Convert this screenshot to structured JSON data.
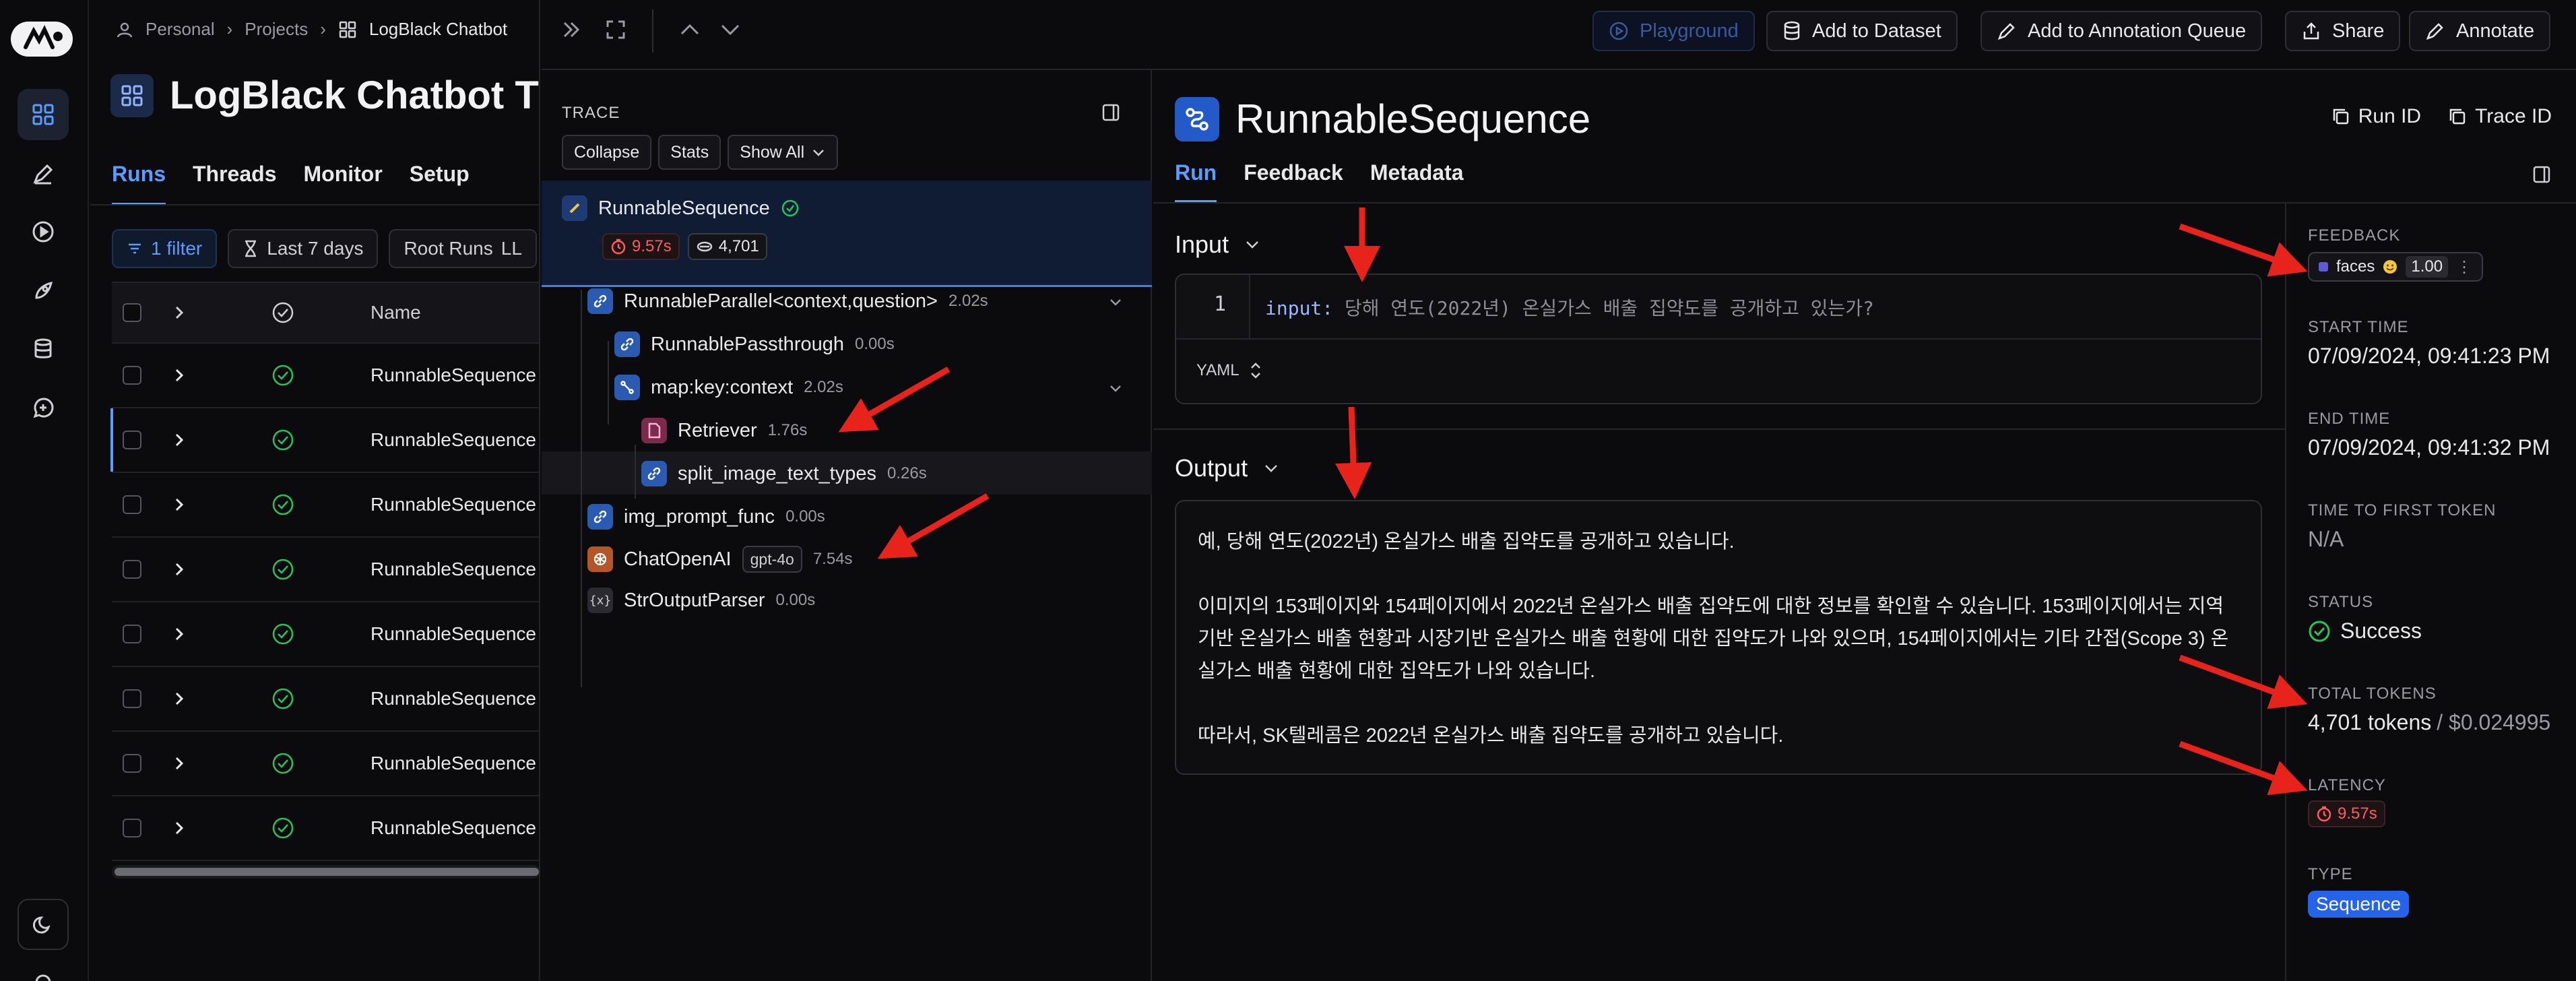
{
  "app": {
    "breadcrumb": [
      "Personal",
      "Projects",
      "LogBlack Chatbot"
    ],
    "project_title": "LogBlack Chatbot T",
    "tabs": [
      "Runs",
      "Threads",
      "Monitor",
      "Setup"
    ],
    "filters": {
      "filter_count": "1 filter",
      "date_range": "Last 7 days",
      "root_runs": "Root Runs",
      "extra": "LL"
    },
    "table": {
      "header_name": "Name",
      "rows": [
        "RunnableSequence",
        "RunnableSequence",
        "RunnableSequence",
        "RunnableSequence",
        "RunnableSequence",
        "RunnableSequence",
        "RunnableSequence",
        "RunnableSequence"
      ]
    }
  },
  "toolbar": {
    "playground": "Playground",
    "add_dataset": "Add to Dataset",
    "add_queue": "Add to Annotation Queue",
    "share": "Share",
    "annotate": "Annotate"
  },
  "trace": {
    "label": "TRACE",
    "collapse": "Collapse",
    "stats": "Stats",
    "show_all": "Show All",
    "root": {
      "name": "RunnableSequence",
      "latency": "9.57s",
      "tokens": "4,701"
    },
    "nodes": [
      {
        "name": "RunnableParallel<context,question>",
        "dur": "2.02s"
      },
      {
        "name": "RunnablePassthrough",
        "dur": "0.00s"
      },
      {
        "name": "map:key:context",
        "dur": "2.02s"
      },
      {
        "name": "Retriever",
        "dur": "1.76s"
      },
      {
        "name": "split_image_text_types",
        "dur": "0.26s"
      },
      {
        "name": "img_prompt_func",
        "dur": "0.00s"
      },
      {
        "name": "ChatOpenAI",
        "tag": "gpt-4o",
        "dur": "7.54s"
      },
      {
        "name": "StrOutputParser",
        "dur": "0.00s"
      }
    ]
  },
  "detail": {
    "title": "RunnableSequence",
    "run_id": "Run ID",
    "trace_id": "Trace ID",
    "tabs": [
      "Run",
      "Feedback",
      "Metadata"
    ],
    "input_label": "Input",
    "input_line_no": "1",
    "input_key": "input:",
    "input_value": "당해 연도(2022년) 온실가스 배출 집약도를 공개하고 있는가?",
    "format": "YAML",
    "output_label": "Output",
    "output_paragraphs": [
      "예, 당해 연도(2022년) 온실가스 배출 집약도를 공개하고 있습니다.",
      "이미지의 153페이지와 154페이지에서 2022년 온실가스 배출 집약도에 대한 정보를 확인할 수 있습니다. 153페이지에서는 지역기반 온실가스 배출 현황과 시장기반 온실가스 배출 현황에 대한 집약도가 나와 있으며, 154페이지에서는 기타 간접(Scope 3) 온실가스 배출 현황에 대한 집약도가 나와 있습니다.",
      "따라서, SK텔레콤은 2022년 온실가스 배출 집약도를 공개하고 있습니다."
    ]
  },
  "meta": {
    "feedback_label": "FEEDBACK",
    "feedback_key": "faces",
    "feedback_score": "1.00",
    "start_label": "START TIME",
    "start": "07/09/2024, 09:41:23 PM",
    "end_label": "END TIME",
    "end": "07/09/2024, 09:41:32 PM",
    "ttft_label": "TIME TO FIRST TOKEN",
    "ttft": "N/A",
    "status_label": "STATUS",
    "status": "Success",
    "tokens_label": "TOTAL TOKENS",
    "tokens": "4,701 tokens",
    "cost": "/ $0.024995",
    "latency_label": "LATENCY",
    "latency": "9.57s",
    "type_label": "TYPE",
    "type": "Sequence"
  },
  "colors": {
    "accent": "#5b9cff",
    "success": "#22c55e",
    "danger": "#ff5d5d",
    "annotation_arrow": "#e8231c"
  }
}
